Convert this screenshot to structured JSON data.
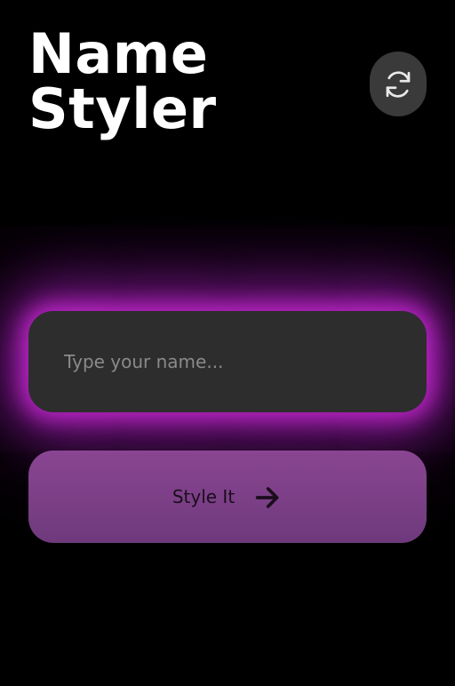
{
  "header": {
    "title_line1": "Name",
    "title_line2": "Styler",
    "refresh_icon": "refresh-icon"
  },
  "form": {
    "name_value": "",
    "name_placeholder": "Type your name...",
    "submit_label": "Style It",
    "submit_icon": "arrow-right-icon"
  },
  "colors": {
    "background": "#000000",
    "glow": "#c828d2",
    "input_bg": "#2d2d2d",
    "button_bg": "#7d3f88",
    "refresh_bg": "#3a3a3a"
  }
}
